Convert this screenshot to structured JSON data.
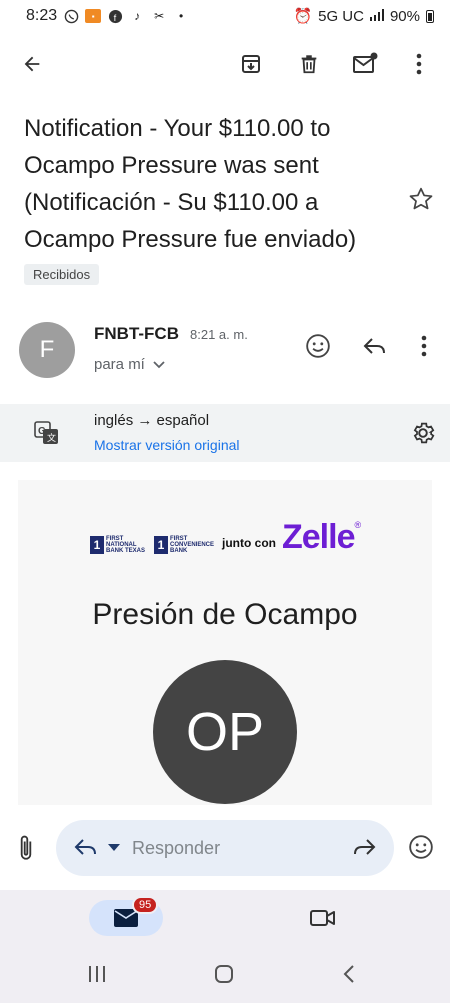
{
  "status_bar": {
    "time": "8:23",
    "network": "5G UC",
    "battery": "90%"
  },
  "toolbar": {
    "back_icon": "arrow-back-icon",
    "archive_icon": "archive-icon",
    "delete_icon": "trash-icon",
    "unread_icon": "mark-unread-icon",
    "more_icon": "more-vert-icon"
  },
  "email": {
    "subject": "Notification - Your  $110.00 to Ocampo Pressure was sent (Notificación - Su $110.00 a Ocampo Pressure fue enviado)",
    "label": "Recibidos",
    "sender_initial": "F",
    "sender_name": "FNBT-FCB",
    "time": "8:21 a. m.",
    "recipient": "para mí"
  },
  "translation": {
    "languages": "inglés → español",
    "show_original": "Mostrar versión original"
  },
  "body": {
    "bank1_text": "FIRST NATIONAL BANK TEXAS",
    "bank2_text": "FIRST CONVENIENCE BANK",
    "junto_con": "junto con",
    "zelle": "Zelle",
    "payee": "Presión de Ocampo",
    "initials": "OP"
  },
  "reply_bar": {
    "placeholder": "Responder"
  },
  "bottom_nav": {
    "mail_badge": "95"
  },
  "colors": {
    "link": "#1a73e8",
    "zelle_purple": "#6d1ed4",
    "badge_red": "#c5221f"
  }
}
